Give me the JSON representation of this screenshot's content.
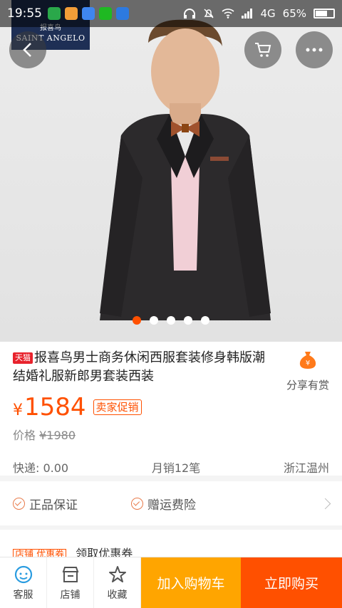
{
  "status_bar": {
    "time": "19:55",
    "network": "4G",
    "battery": "65%"
  },
  "brand": {
    "name_cn": "报喜鸟",
    "name_en": "SAINT ANGELO"
  },
  "carousel": {
    "count": 5,
    "active_index": 0
  },
  "product": {
    "badge": "天猫",
    "title": "报喜鸟男士商务休闲西服套装修身韩版潮结婚礼服新郎男套装西装",
    "currency": "¥",
    "price": "1584",
    "promo_tag": "卖家促销",
    "orig_label": "价格",
    "orig_price": "¥1980",
    "shipping": "快递: 0.00",
    "monthly_sales": "月销12笔",
    "location": "浙江温州"
  },
  "share": {
    "label": "分享有赏"
  },
  "guarantees": [
    {
      "label": "正品保证"
    },
    {
      "label": "赠运费险"
    }
  ],
  "coupon": {
    "tag": "店铺 优惠券",
    "label": "领取优惠券"
  },
  "bottom_bar": {
    "service": "客服",
    "shop": "店铺",
    "favorite": "收藏",
    "add_to_cart": "加入购物车",
    "buy_now": "立即购买"
  },
  "colors": {
    "accent": "#ff5000",
    "cart": "#ffa500",
    "tmall": "#e8222c"
  }
}
